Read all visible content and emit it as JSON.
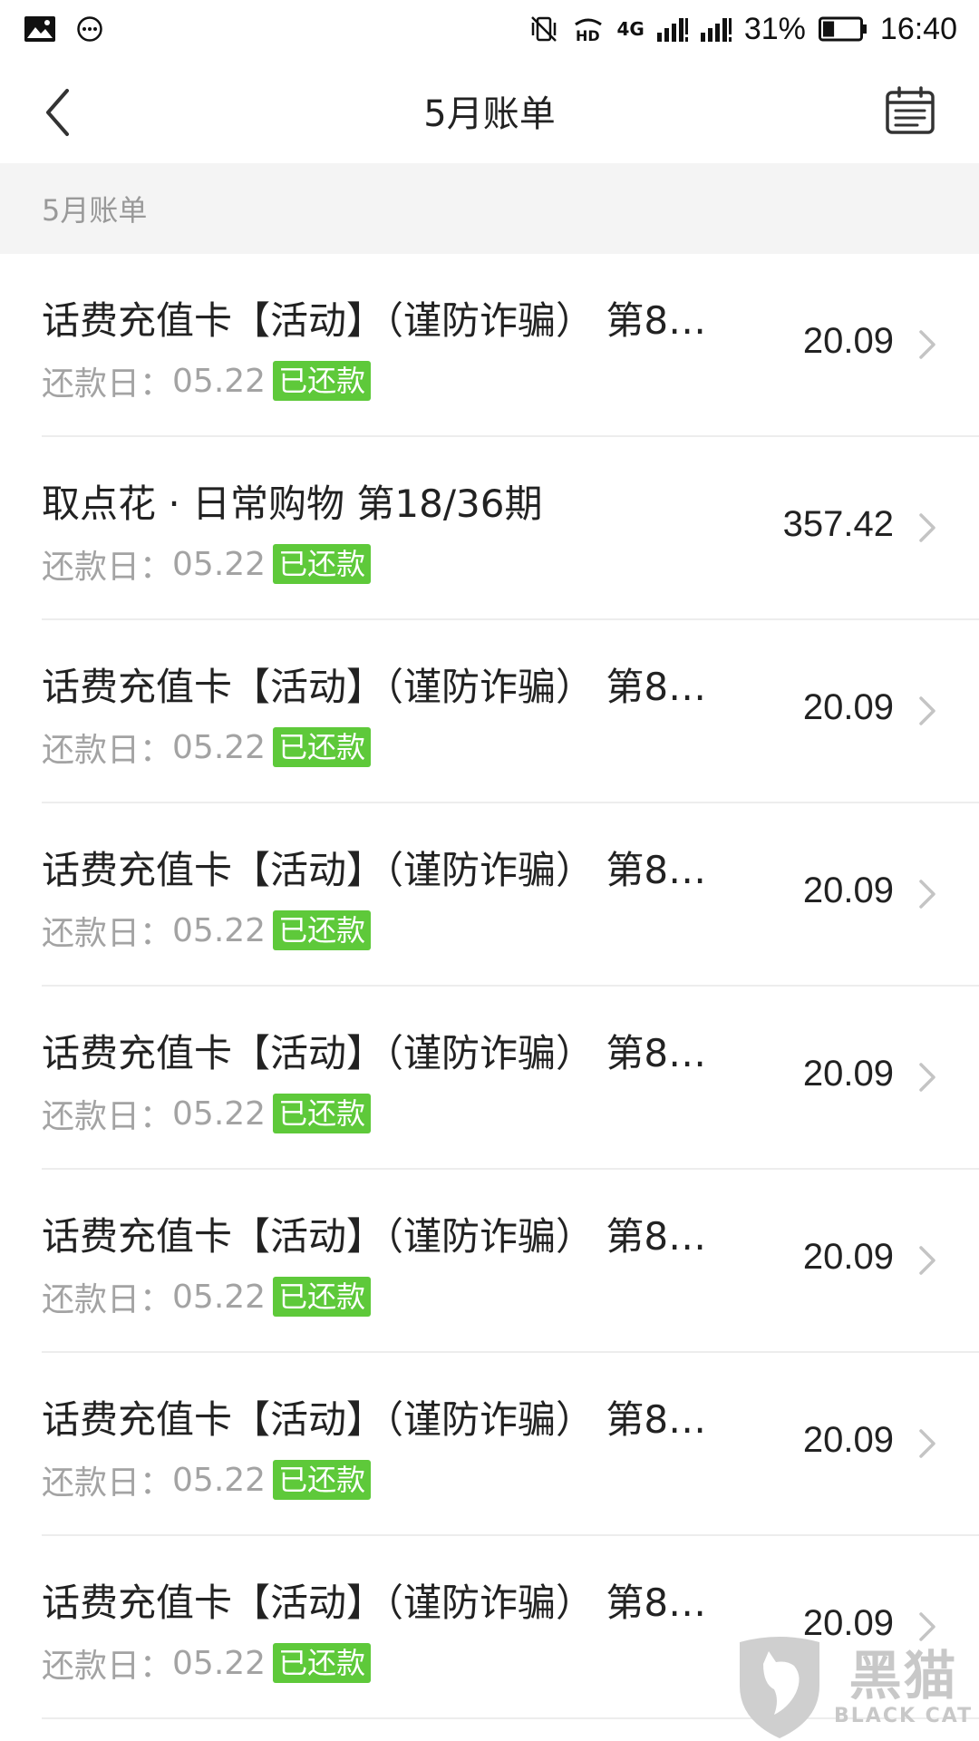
{
  "status_bar": {
    "signal_label": "4G",
    "battery_percent": "31%",
    "battery_level": 0.31,
    "time": "16:40"
  },
  "header": {
    "title": "5月账单"
  },
  "section": {
    "title": "5月账单"
  },
  "bills": [
    {
      "name": "话费充值卡【活动】（谨防诈骗） 第8…",
      "due_label": "还款日：",
      "due_date": "05.22",
      "status": "已还款",
      "amount": "20.09"
    },
    {
      "name": "取点花 · 日常购物 第18/36期",
      "due_label": "还款日：",
      "due_date": "05.22",
      "status": "已还款",
      "amount": "357.42"
    },
    {
      "name": "话费充值卡【活动】（谨防诈骗） 第8…",
      "due_label": "还款日：",
      "due_date": "05.22",
      "status": "已还款",
      "amount": "20.09"
    },
    {
      "name": "话费充值卡【活动】（谨防诈骗） 第8…",
      "due_label": "还款日：",
      "due_date": "05.22",
      "status": "已还款",
      "amount": "20.09"
    },
    {
      "name": "话费充值卡【活动】（谨防诈骗） 第8…",
      "due_label": "还款日：",
      "due_date": "05.22",
      "status": "已还款",
      "amount": "20.09"
    },
    {
      "name": "话费充值卡【活动】（谨防诈骗） 第8…",
      "due_label": "还款日：",
      "due_date": "05.22",
      "status": "已还款",
      "amount": "20.09"
    },
    {
      "name": "话费充值卡【活动】（谨防诈骗） 第8…",
      "due_label": "还款日：",
      "due_date": "05.22",
      "status": "已还款",
      "amount": "20.09"
    },
    {
      "name": "话费充值卡【活动】（谨防诈骗） 第8…",
      "due_label": "还款日：",
      "due_date": "05.22",
      "status": "已还款",
      "amount": "20.09"
    }
  ],
  "colors": {
    "paid_badge": "#5ec93a",
    "section_bg": "#f4f4f4",
    "muted_text": "#a3a3a3"
  },
  "watermark": {
    "text_cn": "黑猫",
    "text_en": "BLACK CAT"
  },
  "icons": {
    "back": "chevron-left-icon",
    "calendar": "calendar-icon",
    "row_arrow": "chevron-right-icon"
  }
}
